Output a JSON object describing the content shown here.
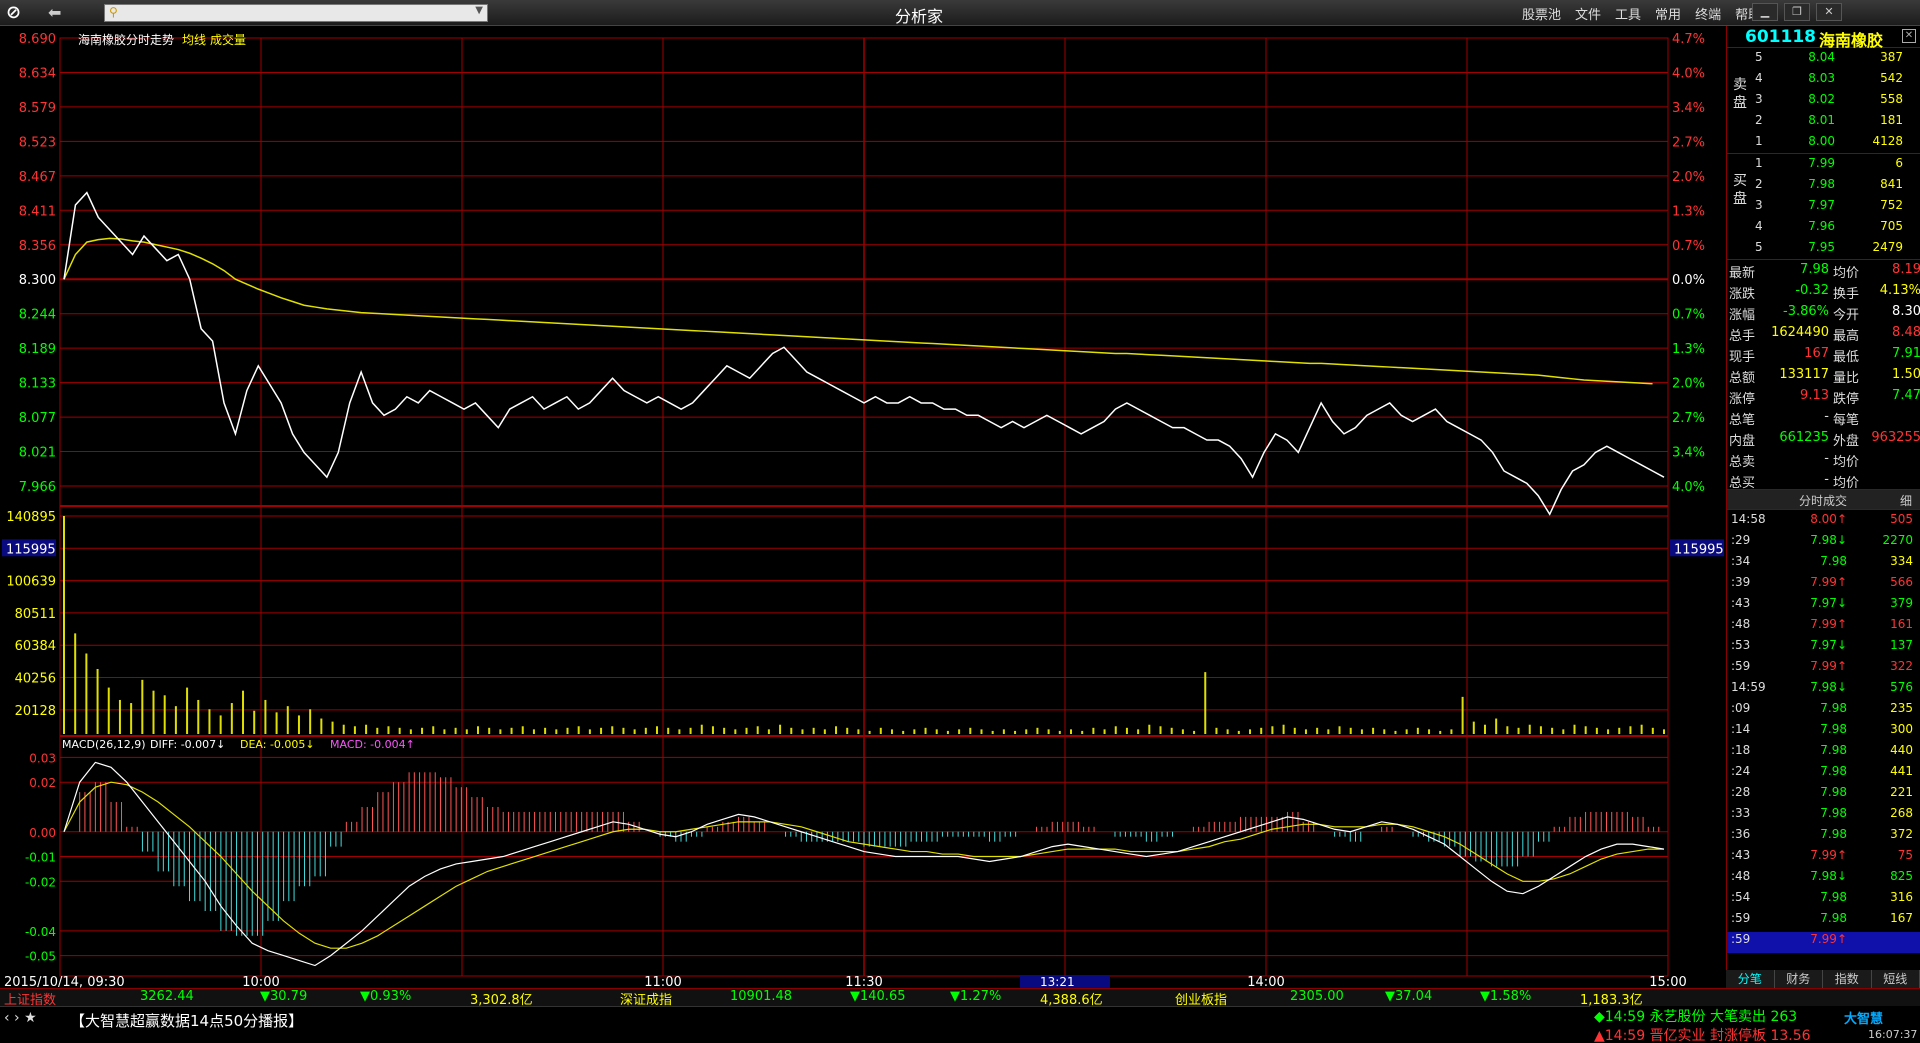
{
  "app": {
    "title": "分析家",
    "menu": [
      "股票池",
      "文件",
      "工具",
      "常用",
      "终端",
      "帮助"
    ],
    "search_placeholder": ""
  },
  "stock": {
    "code": "601118",
    "name": "海南橡胶"
  },
  "chart_header": {
    "title": "海南橡胶分时走势",
    "avg_label": "均线",
    "vol_label": "成交量"
  },
  "macd_header": {
    "name": "MACD(26,12,9)",
    "diff": "DIFF: -0.007↓",
    "dea": "DEA: -0.005↓",
    "macd": "MACD: -0.004↑"
  },
  "colors": {
    "up": "#ff3333",
    "down": "#00ff00",
    "grid": "#a00000",
    "price_line": "#ffffff",
    "avg_line": "#e0e000",
    "macd_up": "#ff5555",
    "macd_down": "#44dddd"
  },
  "chart_data": {
    "type": "line",
    "prev_close": 8.3,
    "ylim": [
      7.91,
      8.69
    ],
    "price_ticks": [
      "8.690",
      "8.634",
      "8.579",
      "8.523",
      "8.467",
      "8.411",
      "8.356",
      "8.300",
      "8.244",
      "8.189",
      "8.133",
      "8.077",
      "8.021",
      "7.966"
    ],
    "pct_ticks": [
      "4.7%",
      "4.0%",
      "3.4%",
      "2.7%",
      "2.0%",
      "1.3%",
      "0.7%",
      "0.0%",
      "0.7%",
      "1.3%",
      "2.0%",
      "2.7%",
      "3.4%",
      "4.0%"
    ],
    "time_labels": [
      "2015/10/14, 09:30",
      "10:00",
      "11:00",
      "11:30",
      "14:00",
      "15:00"
    ],
    "current_time_label": "13:21",
    "price": [
      8.3,
      8.42,
      8.44,
      8.4,
      8.38,
      8.36,
      8.34,
      8.37,
      8.35,
      8.33,
      8.34,
      8.3,
      8.22,
      8.2,
      8.1,
      8.05,
      8.12,
      8.16,
      8.13,
      8.1,
      8.05,
      8.02,
      8.0,
      7.98,
      8.02,
      8.1,
      8.15,
      8.1,
      8.08,
      8.09,
      8.11,
      8.1,
      8.12,
      8.11,
      8.1,
      8.09,
      8.1,
      8.08,
      8.06,
      8.09,
      8.1,
      8.11,
      8.09,
      8.1,
      8.11,
      8.09,
      8.1,
      8.12,
      8.14,
      8.12,
      8.11,
      8.1,
      8.11,
      8.1,
      8.09,
      8.1,
      8.12,
      8.14,
      8.16,
      8.15,
      8.14,
      8.16,
      8.18,
      8.19,
      8.17,
      8.15,
      8.14,
      8.13,
      8.12,
      8.11,
      8.1,
      8.11,
      8.1,
      8.1,
      8.11,
      8.1,
      8.1,
      8.09,
      8.09,
      8.08,
      8.08,
      8.07,
      8.06,
      8.07,
      8.06,
      8.07,
      8.08,
      8.07,
      8.06,
      8.05,
      8.06,
      8.07,
      8.09,
      8.1,
      8.09,
      8.08,
      8.07,
      8.06,
      8.06,
      8.05,
      8.04,
      8.04,
      8.03,
      8.01,
      7.98,
      8.02,
      8.05,
      8.04,
      8.02,
      8.06,
      8.1,
      8.07,
      8.05,
      8.06,
      8.08,
      8.09,
      8.1,
      8.08,
      8.07,
      8.08,
      8.09,
      8.07,
      8.06,
      8.05,
      8.04,
      8.02,
      7.99,
      7.98,
      7.97,
      7.95,
      7.92,
      7.96,
      7.99,
      8.0,
      8.02,
      8.03,
      8.02,
      8.01,
      8.0,
      7.99,
      7.98
    ],
    "avg": [
      8.3,
      8.34,
      8.36,
      8.364,
      8.366,
      8.365,
      8.362,
      8.36,
      8.356,
      8.352,
      8.348,
      8.342,
      8.334,
      8.325,
      8.314,
      8.3,
      8.292,
      8.284,
      8.277,
      8.27,
      8.264,
      8.258,
      8.255,
      8.252,
      8.25,
      8.248,
      8.246,
      8.245,
      8.244,
      8.243,
      8.242,
      8.241,
      8.24,
      8.239,
      8.238,
      8.237,
      8.236,
      8.235,
      8.234,
      8.233,
      8.232,
      8.231,
      8.23,
      8.229,
      8.228,
      8.227,
      8.226,
      8.225,
      8.224,
      8.223,
      8.222,
      8.221,
      8.22,
      8.219,
      8.218,
      8.217,
      8.216,
      8.215,
      8.214,
      8.213,
      8.212,
      8.211,
      8.21,
      8.209,
      8.208,
      8.207,
      8.206,
      8.205,
      8.204,
      8.203,
      8.202,
      8.201,
      8.2,
      8.199,
      8.198,
      8.197,
      8.196,
      8.195,
      8.194,
      8.193,
      8.192,
      8.191,
      8.19,
      8.189,
      8.188,
      8.187,
      8.186,
      8.185,
      8.184,
      8.183,
      8.182,
      8.181,
      8.18,
      8.18,
      8.179,
      8.178,
      8.177,
      8.176,
      8.175,
      8.174,
      8.173,
      8.172,
      8.171,
      8.17,
      8.169,
      8.168,
      8.167,
      8.166,
      8.165,
      8.164,
      8.164,
      8.163,
      8.162,
      8.161,
      8.16,
      8.159,
      8.158,
      8.157,
      8.156,
      8.155,
      8.154,
      8.153,
      8.152,
      8.151,
      8.15,
      8.149,
      8.148,
      8.147,
      8.146,
      8.145,
      8.143,
      8.141,
      8.139,
      8.137,
      8.136,
      8.135,
      8.134,
      8.133,
      8.132,
      8.131
    ],
    "volume_ticks": [
      "140895",
      "115995",
      "100639",
      "80511",
      "60384",
      "40256",
      "20128"
    ],
    "volume_cursor": "115995",
    "volume_max": 140895,
    "volume": [
      140895,
      65000,
      52000,
      42000,
      30000,
      22000,
      20000,
      35000,
      28000,
      25000,
      18000,
      30000,
      22000,
      16000,
      12000,
      20000,
      28000,
      15000,
      22000,
      14000,
      18000,
      12000,
      16000,
      10000,
      8000,
      6000,
      5000,
      6000,
      4000,
      5000,
      4000,
      3000,
      4000,
      5000,
      3000,
      4000,
      3000,
      5000,
      4000,
      3000,
      4000,
      5000,
      3000,
      4000,
      3000,
      4000,
      5000,
      3000,
      4000,
      5000,
      4000,
      3000,
      4000,
      5000,
      4000,
      3000,
      4000,
      6000,
      5000,
      4000,
      3000,
      4000,
      5000,
      3000,
      6000,
      4000,
      3000,
      4000,
      3000,
      5000,
      4000,
      3000,
      2000,
      4000,
      3000,
      2000,
      3000,
      4000,
      3000,
      2000,
      3000,
      4000,
      3000,
      2000,
      3000,
      2000,
      3000,
      4000,
      3000,
      2000,
      3000,
      2000,
      4000,
      3000,
      5000,
      4000,
      3000,
      6000,
      5000,
      4000,
      3000,
      2000,
      40000,
      4000,
      3000,
      2000,
      3000,
      4000,
      5000,
      6000,
      4000,
      3000,
      4000,
      3000,
      5000,
      4000,
      3000,
      4000,
      3000,
      2000,
      3000,
      4000,
      3000,
      2000,
      3000,
      24000,
      8000,
      6000,
      10000,
      5000,
      4000,
      6000,
      5000,
      4000,
      3000,
      6000,
      5000,
      4000,
      3000,
      4000,
      5000,
      6000,
      4000,
      3000
    ],
    "macd_ticks": [
      "0.03",
      "0.02",
      "0.00",
      "-0.01",
      "-0.02",
      "-0.04",
      "-0.05"
    ],
    "macd_ylim": [
      -0.055,
      0.033
    ],
    "diff": [
      0.0,
      0.02,
      0.028,
      0.026,
      0.02,
      0.012,
      0.004,
      -0.004,
      -0.012,
      -0.02,
      -0.03,
      -0.038,
      -0.045,
      -0.048,
      -0.05,
      -0.052,
      -0.054,
      -0.05,
      -0.045,
      -0.04,
      -0.034,
      -0.028,
      -0.022,
      -0.018,
      -0.015,
      -0.013,
      -0.012,
      -0.011,
      -0.01,
      -0.008,
      -0.006,
      -0.004,
      -0.002,
      0.0,
      0.002,
      0.004,
      0.003,
      0.001,
      -0.001,
      -0.002,
      0.0,
      0.003,
      0.005,
      0.007,
      0.006,
      0.004,
      0.002,
      0.0,
      -0.002,
      -0.004,
      -0.006,
      -0.008,
      -0.009,
      -0.01,
      -0.01,
      -0.01,
      -0.01,
      -0.01,
      -0.011,
      -0.012,
      -0.011,
      -0.01,
      -0.008,
      -0.006,
      -0.005,
      -0.006,
      -0.007,
      -0.008,
      -0.009,
      -0.01,
      -0.009,
      -0.008,
      -0.006,
      -0.004,
      -0.002,
      0.0,
      0.002,
      0.004,
      0.006,
      0.005,
      0.003,
      0.001,
      0.0,
      0.002,
      0.004,
      0.003,
      0.001,
      -0.002,
      -0.005,
      -0.01,
      -0.015,
      -0.02,
      -0.024,
      -0.025,
      -0.022,
      -0.018,
      -0.014,
      -0.01,
      -0.007,
      -0.005,
      -0.005,
      -0.006,
      -0.007
    ],
    "dea": [
      0.0,
      0.012,
      0.018,
      0.02,
      0.019,
      0.016,
      0.012,
      0.007,
      0.002,
      -0.004,
      -0.01,
      -0.017,
      -0.024,
      -0.03,
      -0.036,
      -0.041,
      -0.045,
      -0.047,
      -0.047,
      -0.045,
      -0.042,
      -0.038,
      -0.034,
      -0.03,
      -0.026,
      -0.022,
      -0.019,
      -0.016,
      -0.014,
      -0.012,
      -0.01,
      -0.008,
      -0.006,
      -0.004,
      -0.002,
      0.0,
      0.001,
      0.001,
      0.0,
      0.0,
      0.001,
      0.002,
      0.003,
      0.004,
      0.004,
      0.004,
      0.003,
      0.002,
      0.0,
      -0.002,
      -0.004,
      -0.005,
      -0.006,
      -0.007,
      -0.008,
      -0.008,
      -0.009,
      -0.009,
      -0.01,
      -0.01,
      -0.01,
      -0.01,
      -0.009,
      -0.008,
      -0.007,
      -0.007,
      -0.007,
      -0.007,
      -0.008,
      -0.008,
      -0.008,
      -0.008,
      -0.007,
      -0.006,
      -0.004,
      -0.003,
      -0.001,
      0.001,
      0.002,
      0.003,
      0.003,
      0.002,
      0.002,
      0.002,
      0.003,
      0.003,
      0.002,
      0.0,
      -0.002,
      -0.005,
      -0.009,
      -0.013,
      -0.017,
      -0.02,
      -0.02,
      -0.019,
      -0.017,
      -0.014,
      -0.011,
      -0.009,
      -0.008,
      -0.007,
      -0.007
    ]
  },
  "orderbook": {
    "sell_label": "卖盘",
    "buy_label": "买盘",
    "sell": [
      {
        "lv": "5",
        "price": "8.04",
        "vol": "387"
      },
      {
        "lv": "4",
        "price": "8.03",
        "vol": "542"
      },
      {
        "lv": "3",
        "price": "8.02",
        "vol": "558"
      },
      {
        "lv": "2",
        "price": "8.01",
        "vol": "181"
      },
      {
        "lv": "1",
        "price": "8.00",
        "vol": "4128"
      }
    ],
    "buy": [
      {
        "lv": "1",
        "price": "7.99",
        "vol": "6"
      },
      {
        "lv": "2",
        "price": "7.98",
        "vol": "841"
      },
      {
        "lv": "3",
        "price": "7.97",
        "vol": "752"
      },
      {
        "lv": "4",
        "price": "7.96",
        "vol": "705"
      },
      {
        "lv": "5",
        "price": "7.95",
        "vol": "2479"
      }
    ]
  },
  "quotes": [
    {
      "k1": "最新",
      "v1": "7.98",
      "c1": "#00ff00",
      "k2": "均价",
      "v2": "8.19",
      "c2": "#ff3333"
    },
    {
      "k1": "涨跌",
      "v1": "-0.32",
      "c1": "#00ff00",
      "k2": "换手",
      "v2": "4.13%",
      "c2": "#ffff00"
    },
    {
      "k1": "涨幅",
      "v1": "-3.86%",
      "c1": "#00ff00",
      "k2": "今开",
      "v2": "8.30",
      "c2": "#ffffff"
    },
    {
      "k1": "总手",
      "v1": "1624490",
      "c1": "#ffff00",
      "k2": "最高",
      "v2": "8.48",
      "c2": "#ff3333"
    },
    {
      "k1": "现手",
      "v1": "167",
      "c1": "#ff3333",
      "k2": "最低",
      "v2": "7.91",
      "c2": "#00ff00"
    },
    {
      "k1": "总额",
      "v1": "133117",
      "c1": "#ffff00",
      "k2": "量比",
      "v2": "1.50",
      "c2": "#ffff00"
    },
    {
      "k1": "涨停",
      "v1": "9.13",
      "c1": "#ff3333",
      "k2": "跌停",
      "v2": "7.47",
      "c2": "#00ff00"
    },
    {
      "k1": "总笔",
      "v1": "-",
      "c1": "#dddddd",
      "k2": "每笔",
      "v2": "",
      "c2": "#dddddd"
    },
    {
      "k1": "内盘",
      "v1": "661235",
      "c1": "#00ff00",
      "k2": "外盘",
      "v2": "963255",
      "c2": "#ff3333"
    },
    {
      "k1": "总卖",
      "v1": "-",
      "c1": "#dddddd",
      "k2": "均价",
      "v2": "",
      "c2": "#dddddd"
    },
    {
      "k1": "总买",
      "v1": "-",
      "c1": "#dddddd",
      "k2": "均价",
      "v2": "",
      "c2": "#dddddd"
    }
  ],
  "ticks_header": {
    "title": "分时成交",
    "button": "细"
  },
  "ticks": [
    {
      "t": "14:58",
      "p": "8.00↑",
      "pc": "#ff3333",
      "v": "505",
      "vc": "#ff3333"
    },
    {
      "t": ":29",
      "p": "7.98↓",
      "pc": "#00ff00",
      "v": "2270",
      "vc": "#00ff00"
    },
    {
      "t": ":34",
      "p": "7.98",
      "pc": "#00ff00",
      "v": "334",
      "vc": "#ffff00"
    },
    {
      "t": ":39",
      "p": "7.99↑",
      "pc": "#ff3333",
      "v": "566",
      "vc": "#ff3333"
    },
    {
      "t": ":43",
      "p": "7.97↓",
      "pc": "#00ff00",
      "v": "379",
      "vc": "#00ff00"
    },
    {
      "t": ":48",
      "p": "7.99↑",
      "pc": "#ff3333",
      "v": "161",
      "vc": "#ff3333"
    },
    {
      "t": ":53",
      "p": "7.97↓",
      "pc": "#00ff00",
      "v": "137",
      "vc": "#00ff00"
    },
    {
      "t": ":59",
      "p": "7.99↑",
      "pc": "#ff3333",
      "v": "322",
      "vc": "#ff3333"
    },
    {
      "t": "14:59",
      "p": "7.98↓",
      "pc": "#00ff00",
      "v": "576",
      "vc": "#00ff00"
    },
    {
      "t": ":09",
      "p": "7.98",
      "pc": "#00ff00",
      "v": "235",
      "vc": "#ffff00"
    },
    {
      "t": ":14",
      "p": "7.98",
      "pc": "#00ff00",
      "v": "300",
      "vc": "#ffff00"
    },
    {
      "t": ":18",
      "p": "7.98",
      "pc": "#00ff00",
      "v": "440",
      "vc": "#ffff00"
    },
    {
      "t": ":24",
      "p": "7.98",
      "pc": "#00ff00",
      "v": "441",
      "vc": "#ffff00"
    },
    {
      "t": ":28",
      "p": "7.98",
      "pc": "#00ff00",
      "v": "221",
      "vc": "#ffff00"
    },
    {
      "t": ":33",
      "p": "7.98",
      "pc": "#00ff00",
      "v": "268",
      "vc": "#ffff00"
    },
    {
      "t": ":36",
      "p": "7.98",
      "pc": "#00ff00",
      "v": "372",
      "vc": "#ffff00"
    },
    {
      "t": ":43",
      "p": "7.99↑",
      "pc": "#ff3333",
      "v": "75",
      "vc": "#ff3333"
    },
    {
      "t": ":48",
      "p": "7.98↓",
      "pc": "#00ff00",
      "v": "825",
      "vc": "#00ff00"
    },
    {
      "t": ":54",
      "p": "7.98",
      "pc": "#00ff00",
      "v": "316",
      "vc": "#ffff00"
    },
    {
      "t": ":59",
      "p": "7.98",
      "pc": "#00ff00",
      "v": "167",
      "vc": "#ffff00"
    },
    {
      "t": ":59",
      "p": "7.99↑",
      "pc": "#ff3333",
      "v": "",
      "vc": "#ff3333"
    }
  ],
  "side_tabs": [
    "分笔",
    "财务",
    "指数",
    "短线"
  ],
  "status": [
    {
      "text": "上证指数",
      "c": "#ff3333"
    },
    {
      "text": "3262.44",
      "c": "#00ff00"
    },
    {
      "text": "▼30.79",
      "c": "#00ff00"
    },
    {
      "text": "▼0.93%",
      "c": "#00ff00"
    },
    {
      "text": "3,302.8亿",
      "c": "#ffff00"
    },
    {
      "text": "深证成指",
      "c": "#ffff00"
    },
    {
      "text": "10901.48",
      "c": "#00ff00"
    },
    {
      "text": "▼140.65",
      "c": "#00ff00"
    },
    {
      "text": "▼1.27%",
      "c": "#00ff00"
    },
    {
      "text": "4,388.6亿",
      "c": "#ffff00"
    },
    {
      "text": "创业板指",
      "c": "#ffff00"
    },
    {
      "text": "2305.00",
      "c": "#00ff00"
    },
    {
      "text": "▼37.04",
      "c": "#00ff00"
    },
    {
      "text": "▼1.58%",
      "c": "#00ff00"
    },
    {
      "text": "1,183.3亿",
      "c": "#ffff00"
    }
  ],
  "news": {
    "text": "【大智慧超赢数据14点50分播报】"
  },
  "alerts": {
    "a1": "◆14:59 永艺股份 大笔卖出 263",
    "a2": "▲14:59 晋亿实业 封涨停板 13.56"
  },
  "brand": "大智慧",
  "clock": "16:07:37"
}
